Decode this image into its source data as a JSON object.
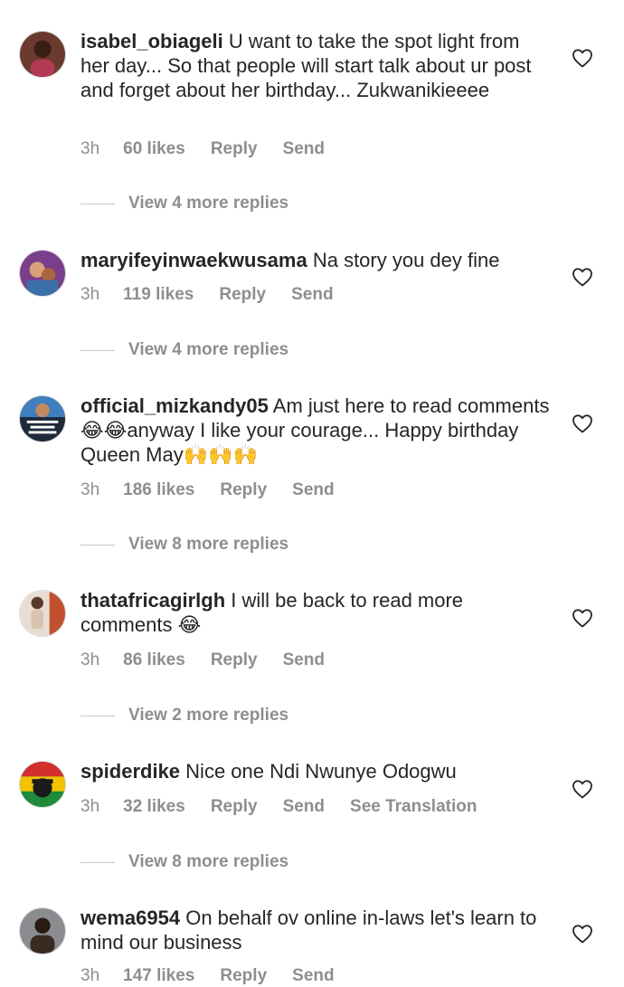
{
  "comments": [
    {
      "username": "isabel_obiageli",
      "text": "U want to take the spot light from her day... So that people will start talk about ur post and forget about her birthday... Zukwanikieeee",
      "time": "3h",
      "likes": "60 likes",
      "reply": "Reply",
      "send": "Send",
      "view_replies": "View 4 more replies"
    },
    {
      "username": "maryifeyinwaekwusama",
      "text": "Na story you dey fine",
      "time": "3h",
      "likes": "119 likes",
      "reply": "Reply",
      "send": "Send",
      "view_replies": "View 4 more replies"
    },
    {
      "username": "official_mizkandy05",
      "text": "Am just here to read comments 😂😂anyway I like your courage... Happy birthday Queen May🙌🙌🙌",
      "time": "3h",
      "likes": "186 likes",
      "reply": "Reply",
      "send": "Send",
      "view_replies": "View 8 more replies"
    },
    {
      "username": "thatafricagirlgh",
      "text": "I will be back to read more comments 😂",
      "time": "3h",
      "likes": "86 likes",
      "reply": "Reply",
      "send": "Send",
      "view_replies": "View 2 more replies"
    },
    {
      "username": "spiderdike",
      "text": "Nice one Ndi Nwunye Odogwu",
      "time": "3h",
      "likes": "32 likes",
      "reply": "Reply",
      "send": "Send",
      "translation": "See Translation",
      "view_replies": "View 8 more replies"
    },
    {
      "username": "wema6954",
      "text": "On behalf ov online in-laws let's learn to mind our business",
      "time": "3h",
      "likes": "147 likes",
      "reply": "Reply",
      "send": "Send"
    }
  ],
  "icons": {
    "like": "heart-outline-icon"
  },
  "colors": {
    "text": "#262626",
    "muted": "#8e8e8e",
    "divider": "#c7c7c7"
  }
}
